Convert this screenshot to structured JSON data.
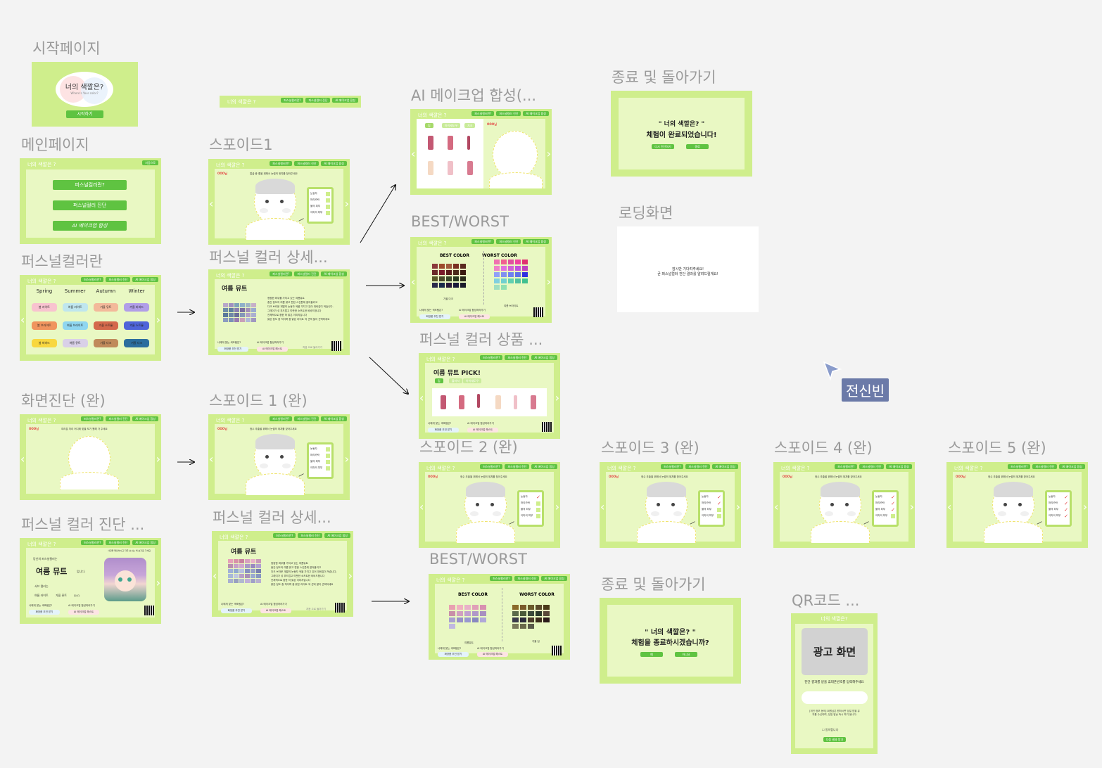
{
  "app_title": "너의 색깔은 ?",
  "nav": {
    "a": "퍼스널컬러란?",
    "b": "퍼스널컬러 진단",
    "c": "AI 메이크업 합성",
    "main_btn": "처음으로"
  },
  "labels": {
    "start": "시작페이지",
    "main": "메인페이지",
    "pc": "퍼스널컬러란",
    "diag": "화면진단 (완)",
    "pcdiag": "퍼스널 컬러 진단 ...",
    "spoid1": "스포이드1",
    "pcdetail1": "퍼스널 컬러 상세...",
    "spoid1done": "스포이드 1 (완)",
    "pcdetail2": "퍼스널 컬러 상세...",
    "ai": "AI 메이크업 합성(...",
    "bw1": "BEST/WORST",
    "product": "퍼스널 컬러 상품 ...",
    "spoid2": "스포이드 2 (완)",
    "bw2": "BEST/WORST",
    "end1": "종료 및 돌아가기",
    "loading": "로딩화면",
    "spoid3": "스포이드 3 (완)",
    "spoid4": "스포이드 4 (완)",
    "spoid5": "스포이드 5 (완)",
    "end2": "종료 및 돌아가기",
    "qr": "QR코드 ..."
  },
  "start": {
    "title": "너의 색깔은?",
    "subtitle": "Where's Your color?",
    "btn": "시작하기"
  },
  "main": {
    "btns": [
      "퍼스널컬러란?",
      "퍼스널컬러 진단",
      "AI 메이크업 합성"
    ]
  },
  "seasons": {
    "headers": [
      "Spring",
      "Summer",
      "Autumn",
      "Winter"
    ],
    "cells": [
      [
        "봄 라이트",
        "여름 라이트",
        "가을 뮤트",
        "겨울 비비드"
      ],
      [
        "봄 브라이트",
        "여름 브라이트",
        "가을 스트롱",
        "겨울 스트롱"
      ],
      [
        "봄 비비드",
        "여름 뮤트",
        "가을 다크",
        "겨울 다크"
      ]
    ],
    "colors": [
      [
        "#f8c3cf",
        "#bfe6ee",
        "#f3b99a",
        "#b19ee8"
      ],
      [
        "#f0945e",
        "#8fd6f0",
        "#d4684c",
        "#4f64d9"
      ],
      [
        "#f8d73f",
        "#d9d0e8",
        "#c08a5b",
        "#2c6d9e"
      ]
    ]
  },
  "spoid": {
    "red": "OOO님",
    "instr": "얼굴 중 좋을 위해서 눈썹의 위치를 찾아주세요",
    "instr2": "정수 추출을 위해서 눈썹의 위치를 찾아주세요",
    "items": [
      "눈동자",
      "머리카락",
      "볼의 피부",
      "이마의 피부"
    ]
  },
  "diag": {
    "instr": "여러분 자리 어디에 맞을 보기 원해 가 주세요"
  },
  "detail": {
    "title": "여름 뮤트",
    "desc": [
      "청량한 파우를 가지고 있는 여름뮤트",
      "중간 정도의 여름 밝고 편한 스킨톤에 잘어울리고",
      "다크 브라운 계열의 눈동자 색을 가지고 있어 대비감이 적습니다.",
      "그레이가 섞 부드럽고 따뜻한 소프트한 비비드합니다",
      "전체적으로 환한 하 밝은 이미지입니다",
      "밝은 정도 중 적이며 중 밝은 라이트 색 선택 많이 선택하세요"
    ],
    "foot1": "나에게 맞는 색조템은?",
    "foot2": "AI 메이크업 합성하러가기",
    "btn1": "화장품 추천 받기",
    "btn2": "AI 메이크업 해스트",
    "foot3": "처음 으로 돌아가기"
  },
  "pcdiag": {
    "line1": "당신의 퍼스널컬러는",
    "type": "여름 뮤트",
    "suffix": "입니다.",
    "sub1": "서브 컬러는",
    "sub2": "여름 라이트",
    "sub3": "가을 뮤트",
    "sub4": "입니다.",
    "top": "사진을 확인하시고 자주 쓰시는 색 보기로 가세요"
  },
  "ai": {
    "tabs": [
      "립",
      "아이섀도우",
      "치크"
    ],
    "red": "OOO님"
  },
  "bw": {
    "best": "BEST COLOR",
    "worst": "WORST COLOR",
    "best_sub": "가을 다크",
    "worst_sub": "여름 브라이트",
    "best_sub2": "여름뮤트",
    "worst_sub2": "가을 딥"
  },
  "product": {
    "title": "여름 뮤트 PICK!",
    "tabs": [
      "립",
      "블러셔",
      "아이섀도우"
    ]
  },
  "end1": {
    "q1": "\" 너의 색깔은? \"",
    "q2": "체험이 완료되었습니다!",
    "btn1": "다시 진단하기",
    "btn2": "종료"
  },
  "loading": {
    "l1": "잠시만 기다려주세요!",
    "l2": "곧 퍼스널컬러 진단 결과를 알려드릴게요!"
  },
  "end2": {
    "q1": "\" 너의 색깔은? \"",
    "q2": "체험을 종료하시겠습니까?",
    "btn1": "예",
    "btn2": "아니요"
  },
  "qr": {
    "title": "너의 색깔은?",
    "ad": "광고 화면",
    "instr": "진단 결과를 받을 휴대폰번호를 입력해주세요",
    "fine": "[개인 정보 동의] 회원님은 원하시면 당일 받을 유지를 수신하며, 당일 발송 즉시 파기 됩니다.",
    "agree": "동의합니다",
    "btn": "다음 결과 받기"
  },
  "user_tag": "전신빈"
}
